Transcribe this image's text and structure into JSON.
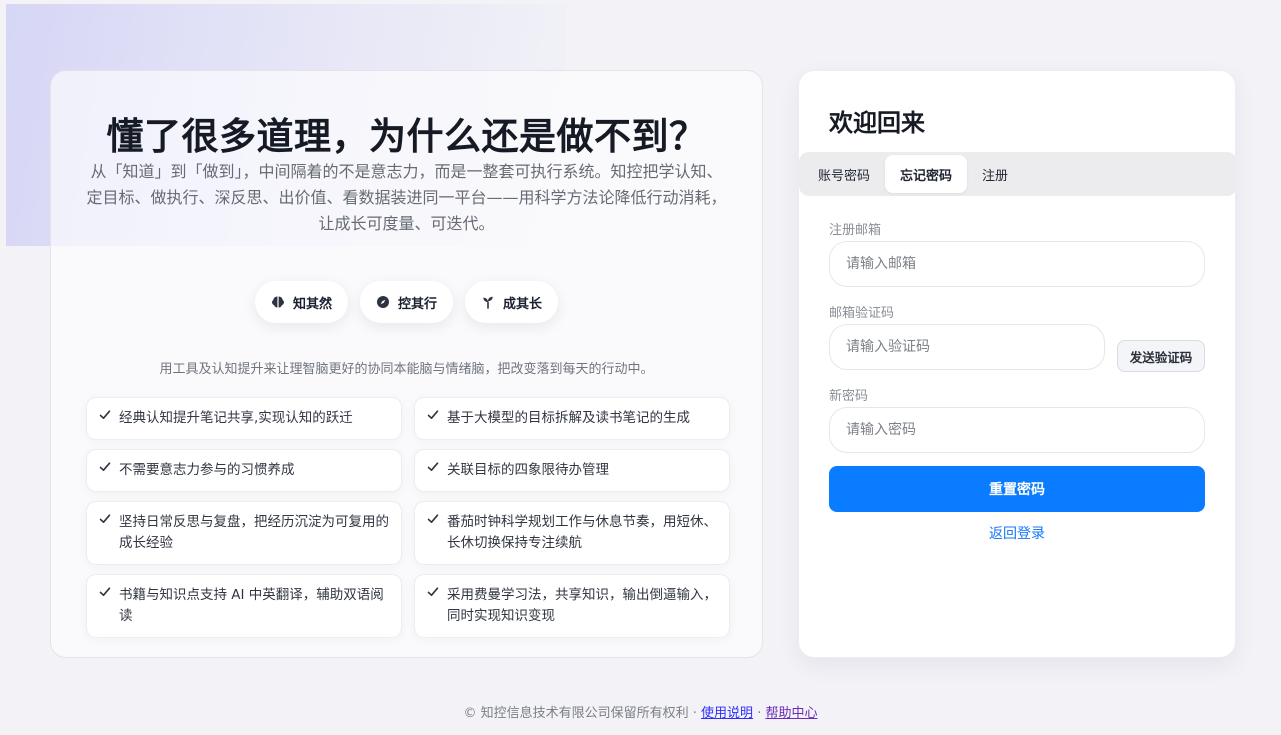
{
  "hero": {
    "title": "懂了很多道理，为什么还是做不到？",
    "description": "从「知道」到「做到」，中间隔着的不是意志力，而是一整套可执行系统。知控把学认知、定目标、做执行、深反思、出价值、看数据装进同一平台——用科学方法论降低行动消耗，让成长可度量、可迭代。",
    "pillars": [
      {
        "label": "知其然",
        "icon": "brain-icon"
      },
      {
        "label": "控其行",
        "icon": "compass-icon"
      },
      {
        "label": "成其长",
        "icon": "sprout-icon"
      }
    ],
    "subline": "用工具及认知提升来让理智脑更好的协同本能脑与情绪脑，把改变落到每天的行动中。",
    "features": [
      {
        "text": "经典认知提升笔记共享,实现认知的跃迁"
      },
      {
        "text": "基于大模型的目标拆解及读书笔记的生成"
      },
      {
        "text": "不需要意志力参与的习惯养成"
      },
      {
        "text": "关联目标的四象限待办管理"
      },
      {
        "text": "坚持日常反思与复盘，把经历沉淀为可复用的成长经验"
      },
      {
        "text": "番茄时钟科学规划工作与休息节奏，用短休、长休切换保持专注续航"
      },
      {
        "text": "书籍与知识点支持 AI 中英翻译，辅助双语阅读"
      },
      {
        "text": "采用费曼学习法，共享知识，输出倒逼输入，同时实现知识变现"
      }
    ]
  },
  "login": {
    "welcome": "欢迎回来",
    "tabs": [
      {
        "label": "账号密码",
        "active": false
      },
      {
        "label": "忘记密码",
        "active": true
      },
      {
        "label": "注册",
        "active": false
      }
    ],
    "email": {
      "label": "注册邮箱",
      "value": "",
      "placeholder": "请输入邮箱"
    },
    "code": {
      "label": "邮箱验证码",
      "value": "",
      "placeholder": "请输入验证码"
    },
    "send_code_label": "发送验证码",
    "password": {
      "label": "新密码",
      "value": "",
      "placeholder": "请输入密码"
    },
    "reset_label": "重置密码",
    "back_label": "返回登录"
  },
  "footer": {
    "copyright": "© 知控信息技术有限公司保留所有权利 · ",
    "usage_link": "使用说明",
    "separator": " · ",
    "help_link": "帮助中心"
  },
  "colors": {
    "primary": "#0a7cff",
    "link": "#1677ff"
  }
}
